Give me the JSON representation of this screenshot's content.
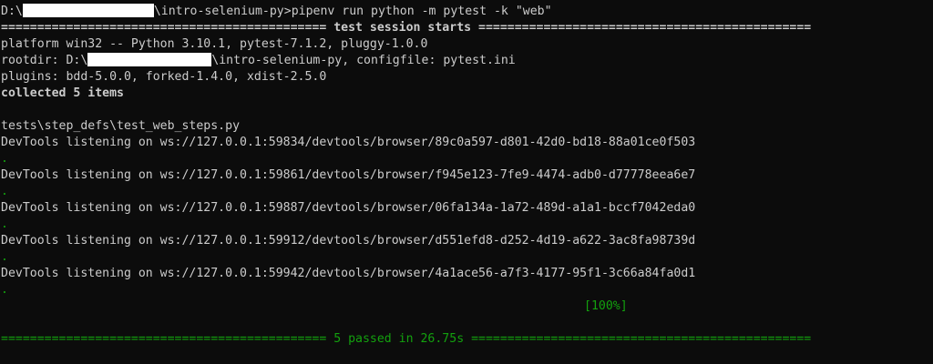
{
  "terminal": {
    "prompt": {
      "drive": "D:\\",
      "path_rest": "\\intro-selenium-py>",
      "command": "pipenv run python -m pytest -k \"web\""
    },
    "session_header": "============================================= test session starts ==============================================",
    "platform_line": "platform win32 -- Python 3.10.1, pytest-7.1.2, pluggy-1.0.0",
    "rootdir": {
      "label": "rootdir: D:\\",
      "rest": "\\intro-selenium-py, configfile: pytest.ini"
    },
    "plugins_line": "plugins: bdd-5.0.0, forked-1.4.0, xdist-2.5.0",
    "collected_line": "collected 5 items",
    "test_file": "tests\\step_defs\\test_web_steps.py",
    "devtools": [
      "DevTools listening on ws://127.0.0.1:59834/devtools/browser/89c0a597-d801-42d0-bd18-88a01ce0f503",
      "DevTools listening on ws://127.0.0.1:59861/devtools/browser/f945e123-7fe9-4474-adb0-d77778eea6e7",
      "DevTools listening on ws://127.0.0.1:59887/devtools/browser/06fa134a-1a72-489d-a1a1-bccf7042eda0",
      "DevTools listening on ws://127.0.0.1:59912/devtools/browser/d551efd8-d252-4d19-a622-3ac8fa98739d",
      "DevTools listening on ws://127.0.0.1:59942/devtools/browser/4a1ace56-a7f3-4177-95f1-3c66a84fa0d1"
    ],
    "pass_dot": ".",
    "percent": "[100%]",
    "summary": "============================================= 5 passed in 26.75s ==============================================="
  },
  "colors": {
    "background": "#0c0c0c",
    "text": "#cccccc",
    "pass_green": "#13a10e",
    "redaction": "#ffffff"
  }
}
